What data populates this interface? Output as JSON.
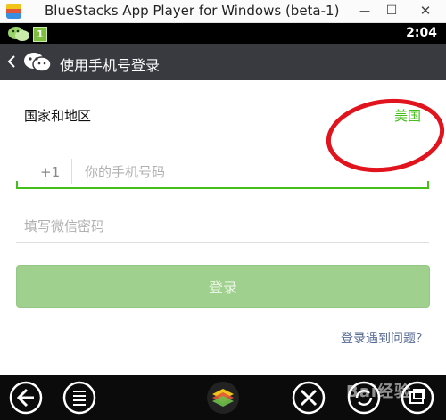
{
  "window": {
    "title": "BlueStacks App Player for Windows (beta-1)",
    "buttons": {
      "minimize": "—",
      "maximize": "☐",
      "close": "✕"
    }
  },
  "statusbar": {
    "time": "2:04",
    "notification_count": "1"
  },
  "actionbar": {
    "title": "使用手机号登录"
  },
  "form": {
    "region_label": "国家和地区",
    "region_value": "美国",
    "country_code": "+1",
    "phone_placeholder": "你的手机号码",
    "password_placeholder": "填写微信密码",
    "login_button": "登录",
    "problem_link": "登录遇到问题？"
  },
  "navbar": {
    "icons": [
      "back-icon",
      "menu-icon",
      "bluestacks-home-icon",
      "settings-tools-icon",
      "rotate-icon",
      "fullscreen-icon"
    ],
    "watermark": "Bai经验"
  },
  "colors": {
    "accent_green": "#45c01a",
    "actionbar_bg": "#393a3f",
    "login_button_bg": "#9fd08e",
    "link_blue": "#576b95",
    "annotation_red": "#e1141e"
  }
}
